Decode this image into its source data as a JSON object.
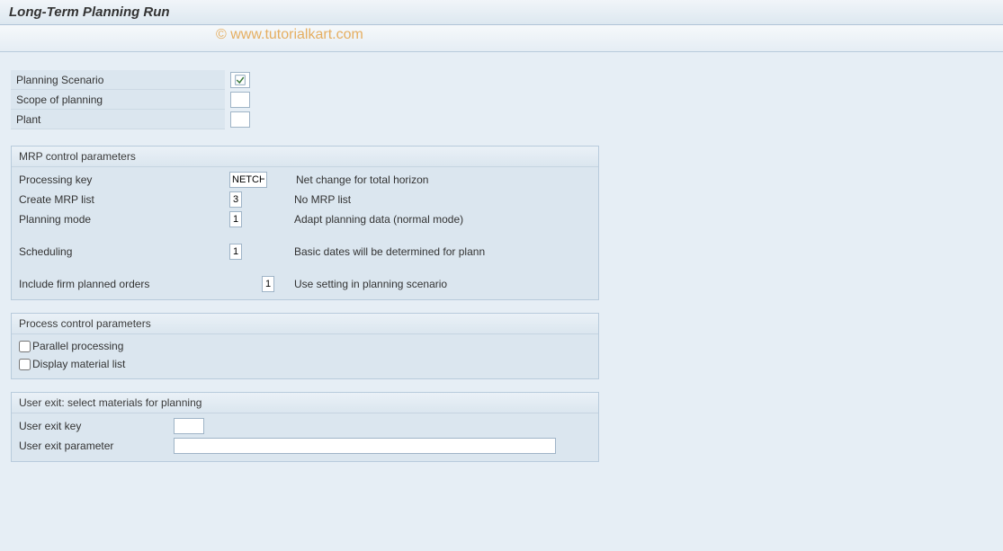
{
  "title": "Long-Term Planning Run",
  "watermark": "© www.tutorialkart.com",
  "top_fields": {
    "planning_scenario_label": "Planning Scenario",
    "planning_scenario_value": "",
    "scope_label": "Scope of planning",
    "scope_value": "",
    "plant_label": "Plant",
    "plant_value": ""
  },
  "mrp": {
    "header": "MRP control parameters",
    "processing_key_label": "Processing key",
    "processing_key_value": "NETCH",
    "processing_key_desc": "Net change for total horizon",
    "create_mrp_label": "Create MRP list",
    "create_mrp_value": "3",
    "create_mrp_desc": "No MRP list",
    "planning_mode_label": "Planning mode",
    "planning_mode_value": "1",
    "planning_mode_desc": "Adapt planning data (normal mode)",
    "scheduling_label": "Scheduling",
    "scheduling_value": "1",
    "scheduling_desc": "Basic dates will be determined for plann",
    "include_firm_label": "Include firm planned orders",
    "include_firm_value": "1",
    "include_firm_desc": "Use setting in planning scenario"
  },
  "process": {
    "header": "Process control parameters",
    "parallel_label": "Parallel processing",
    "display_list_label": "Display material list"
  },
  "user_exit": {
    "header": "User exit: select materials for planning",
    "key_label": "User exit key",
    "key_value": "",
    "param_label": "User exit parameter",
    "param_value": ""
  }
}
